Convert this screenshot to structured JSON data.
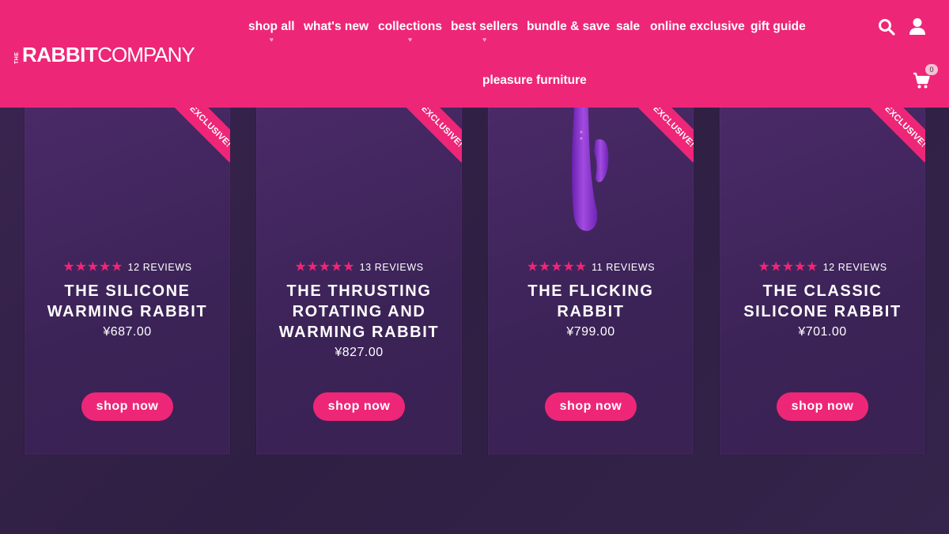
{
  "brand": {
    "the": "THE",
    "rabbit": "RABBIT",
    "company": "COMPANY"
  },
  "nav": {
    "items": [
      {
        "label": "shop all",
        "has_dropdown": true
      },
      {
        "label": "what's new",
        "has_dropdown": false
      },
      {
        "label": "collections",
        "has_dropdown": true
      },
      {
        "label": "best sellers",
        "has_dropdown": true
      },
      {
        "label": "bundle & save",
        "has_dropdown": false
      },
      {
        "label": "sale",
        "has_dropdown": false
      },
      {
        "label": "online exclusive",
        "has_dropdown": false
      },
      {
        "label": "gift guide",
        "has_dropdown": false
      },
      {
        "label": "pleasure furniture",
        "has_dropdown": false
      }
    ],
    "caret_glyph": "♥"
  },
  "header_icons": {
    "search": "search-icon",
    "account": "user-icon",
    "cart": "cart-icon",
    "cart_count": "0"
  },
  "colors": {
    "brand_pink": "#ee2677",
    "card_purple": "#3c2357",
    "page_bg": "#2f1f43"
  },
  "products": [
    {
      "ribbon": "EXCLUSIVE!",
      "stars": "★★★★★",
      "reviews": "12 REVIEWS",
      "title": "THE SILICONE WARMING RABBIT",
      "price": "¥687.00",
      "button": "shop now",
      "rating_value": 5
    },
    {
      "ribbon": "EXCLUSIVE!",
      "stars": "★★★★★",
      "reviews": "13 REVIEWS",
      "title": "THE THRUSTING ROTATING AND WARMING RABBIT",
      "price": "¥827.00",
      "button": "shop now",
      "rating_value": 5
    },
    {
      "ribbon": "EXCLUSIVE!",
      "stars": "★★★★★",
      "reviews": "11 REVIEWS",
      "title": "THE FLICKING RABBIT",
      "price": "¥799.00",
      "button": "shop now",
      "rating_value": 5
    },
    {
      "ribbon": "EXCLUSIVE!",
      "stars": "★★★★★",
      "reviews": "12 REVIEWS",
      "title": "THE CLASSIC SILICONE RABBIT",
      "price": "¥701.00",
      "button": "shop now",
      "rating_value": 5
    }
  ]
}
